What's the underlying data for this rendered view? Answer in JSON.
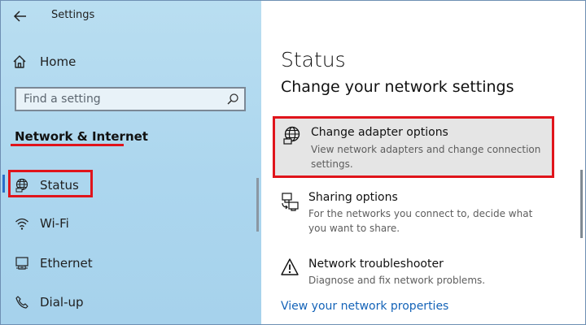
{
  "window": {
    "title": "Settings",
    "controls": [
      "minimize-icon",
      "maximize-icon",
      "close-icon"
    ]
  },
  "sidebar": {
    "home_label": "Home",
    "search": {
      "placeholder": "Find a setting",
      "value": ""
    },
    "section_title": "Network & Internet",
    "items": [
      {
        "label": "Status",
        "icon": "globe-monitor-icon",
        "active": true
      },
      {
        "label": "Wi-Fi",
        "icon": "wifi-icon"
      },
      {
        "label": "Ethernet",
        "icon": "ethernet-icon"
      },
      {
        "label": "Dial-up",
        "icon": "phone-icon"
      }
    ]
  },
  "main": {
    "title": "Status",
    "subtitle": "Change your network settings",
    "options": [
      {
        "title": "Change adapter options",
        "description": "View network adapters and change connection settings.",
        "icon": "globe-monitor-icon"
      },
      {
        "title": "Sharing options",
        "description": "For the networks you connect to, decide what you want to share.",
        "icon": "sharing-icon"
      },
      {
        "title": "Network troubleshooter",
        "description": "Diagnose and fix network problems.",
        "icon": "warning-icon"
      }
    ],
    "link": "View your network properties"
  },
  "colors": {
    "highlight": "#e0141b",
    "link": "#1463b8",
    "accent": "#2b6ec9"
  }
}
